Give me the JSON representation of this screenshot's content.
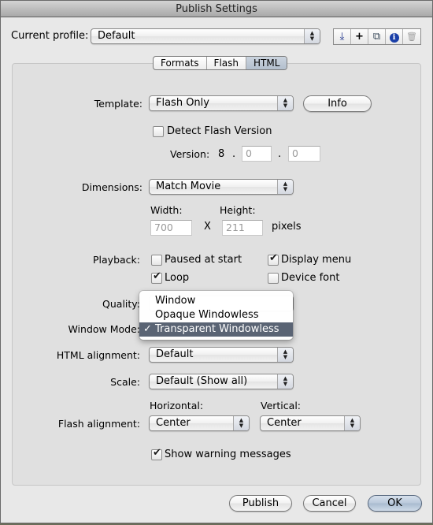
{
  "window": {
    "title": "Publish Settings"
  },
  "profile": {
    "label": "Current profile:",
    "value": "Default",
    "tools": [
      {
        "icon": "import-export-icon",
        "glyph": "⤓"
      },
      {
        "icon": "add-profile-icon",
        "glyph": "+"
      },
      {
        "icon": "duplicate-profile-icon",
        "glyph": "⧉"
      },
      {
        "icon": "profile-info-icon",
        "glyph": "ℹ"
      },
      {
        "icon": "delete-profile-icon",
        "glyph": "🗑"
      }
    ]
  },
  "tabs": [
    {
      "label": "Formats",
      "active": false
    },
    {
      "label": "Flash",
      "active": false
    },
    {
      "label": "HTML",
      "active": true
    }
  ],
  "template": {
    "label": "Template:",
    "value": "Flash Only",
    "info_button": "Info"
  },
  "detect_flash": {
    "label": "Detect Flash Version",
    "checked": false
  },
  "version": {
    "label": "Version:",
    "major": "8",
    "sep": ".",
    "minor": "0",
    "revision": "0"
  },
  "dimensions": {
    "label": "Dimensions:",
    "value": "Match Movie",
    "width_label": "Width:",
    "height_label": "Height:",
    "width": "700",
    "height": "211",
    "times": "X",
    "unit": "pixels"
  },
  "playback": {
    "label": "Playback:",
    "options": [
      {
        "label": "Paused at start",
        "checked": false
      },
      {
        "label": "Display menu",
        "checked": true
      },
      {
        "label": "Loop",
        "checked": true
      },
      {
        "label": "Device font",
        "checked": false
      }
    ]
  },
  "quality": {
    "label": "Quality:"
  },
  "window_mode": {
    "label": "Window Mode:",
    "options": [
      {
        "label": "Window",
        "selected": false
      },
      {
        "label": "Opaque Windowless",
        "selected": false
      },
      {
        "label": "Transparent Windowless",
        "selected": true
      }
    ],
    "check_glyph": "✓"
  },
  "html_alignment": {
    "label": "HTML alignment:",
    "value": "Default"
  },
  "scale": {
    "label": "Scale:",
    "value": "Default (Show all)"
  },
  "flash_alignment": {
    "label": "Flash alignment:",
    "horizontal_label": "Horizontal:",
    "horizontal_value": "Center",
    "vertical_label": "Vertical:",
    "vertical_value": "Center"
  },
  "warnings": {
    "label": "Show warning messages",
    "checked": true
  },
  "buttons": {
    "publish": "Publish",
    "cancel": "Cancel",
    "ok": "OK"
  }
}
